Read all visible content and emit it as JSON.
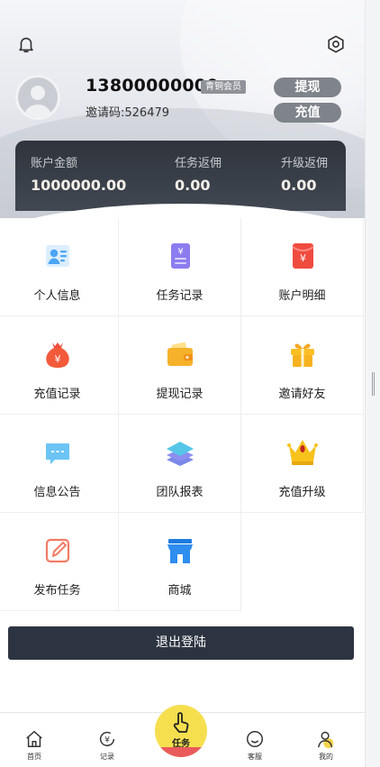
{
  "user": {
    "phone": "13800000000",
    "member_level": "青铜会员",
    "invite_code": "邀请码:526479"
  },
  "header": {
    "bell_icon": "bell-icon",
    "settings_icon": "gear-icon",
    "withdraw_label": "提现",
    "recharge_label": "充值"
  },
  "balance": [
    {
      "label": "账户金额",
      "value": "1000000.00"
    },
    {
      "label": "任务返佣",
      "value": "0.00"
    },
    {
      "label": "升级返佣",
      "value": "0.00"
    }
  ],
  "menu": [
    {
      "label": "个人信息",
      "icon": "id-card-icon"
    },
    {
      "label": "任务记录",
      "icon": "task-list-icon"
    },
    {
      "label": "账户明细",
      "icon": "red-envelope-icon"
    },
    {
      "label": "充值记录",
      "icon": "money-bag-icon"
    },
    {
      "label": "提现记录",
      "icon": "wallet-icon"
    },
    {
      "label": "邀请好友",
      "icon": "gift-icon"
    },
    {
      "label": "信息公告",
      "icon": "message-icon"
    },
    {
      "label": "团队报表",
      "icon": "layers-icon"
    },
    {
      "label": "充值升级",
      "icon": "crown-icon"
    },
    {
      "label": "发布任务",
      "icon": "edit-icon"
    },
    {
      "label": "商城",
      "icon": "store-icon"
    }
  ],
  "logout_label": "退出登陆",
  "tabbar": {
    "items": [
      {
        "label": "首页",
        "icon": "home-icon"
      },
      {
        "label": "记录",
        "icon": "yuan-icon"
      },
      {
        "label": "任务",
        "icon": "tap-icon"
      },
      {
        "label": "客服",
        "icon": "smile-icon"
      },
      {
        "label": "我的",
        "icon": "user-icon"
      }
    ]
  },
  "colors": {
    "card_bg": "#2f343c",
    "pill_bg": "#7f838a",
    "logout_bg": "#2d3441",
    "center_yellow": "#f6df4f",
    "center_red": "#ea5b5b"
  }
}
